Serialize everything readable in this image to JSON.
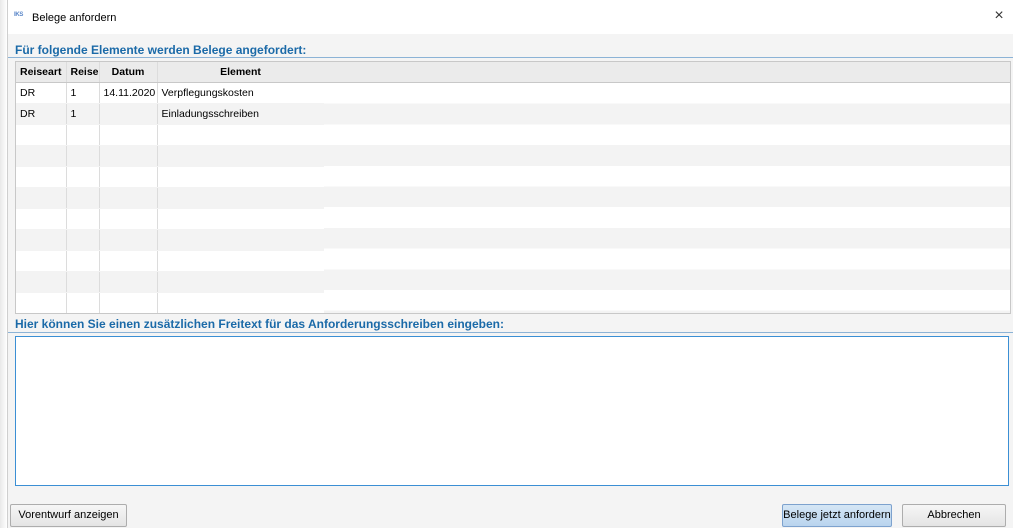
{
  "window": {
    "icon_text": "IKS",
    "title": "Belege anfordern",
    "close_glyph": "×"
  },
  "section1": {
    "title": "Für folgende Elemente werden Belege angefordert:"
  },
  "table": {
    "columns": [
      "Reiseart",
      "Reise",
      "Datum",
      "Element"
    ],
    "rows": [
      {
        "reiseart": "DR",
        "reise": "1",
        "datum": "14.11.2020",
        "element": "Verpflegungskosten"
      },
      {
        "reiseart": "DR",
        "reise": "1",
        "datum": "",
        "element": "Einladungsschreiben"
      }
    ]
  },
  "section2": {
    "title": "Hier können Sie einen zusätzlichen Freitext für das Anforderungsschreiben eingeben:"
  },
  "freetext": {
    "value": ""
  },
  "buttons": {
    "preview": "Vorentwurf anzeigen",
    "submit": "Belege jetzt anfordern",
    "cancel": "Abbrechen"
  },
  "colors": {
    "section_title": "#1b6aa8",
    "primary_button": "#c6ddf2",
    "textarea_focus": "#3b8fd4"
  }
}
